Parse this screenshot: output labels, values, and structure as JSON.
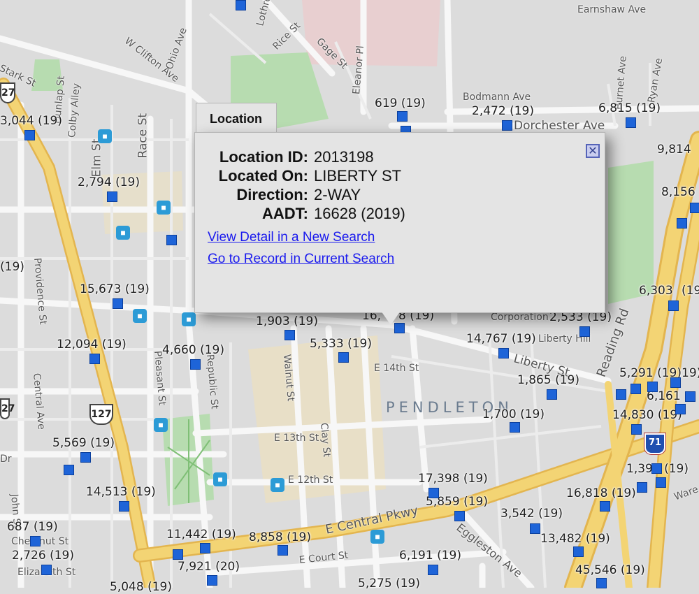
{
  "colors": {
    "marker": "#1e64d8",
    "highway": "#f0cc6a",
    "park": "#b7dcb0",
    "campus": "#eadfc3",
    "popup_bg": "#e4e4e4",
    "link": "#1a1aee"
  },
  "popup": {
    "tab_label": "Location",
    "fields": [
      {
        "key": "Location ID:",
        "value": "2013198"
      },
      {
        "key": "Located On:",
        "value": "LIBERTY ST"
      },
      {
        "key": "Direction:",
        "value": "2-WAY"
      },
      {
        "key": "AADT:",
        "value": "16628 (2019)"
      }
    ],
    "links": [
      {
        "label": "View Detail in a New Search"
      },
      {
        "label": "Go to Record in Current Search"
      }
    ],
    "close_icon": "close-x-icon"
  },
  "count_labels": [
    "3,044 (19)",
    "619 (19)",
    "2,472 (19)",
    "6,815 (19)",
    "9,814",
    "8,156",
    "2,794 (19)",
    "15,673 (19)",
    "1,903 (19)",
    "16,",
    "8 (19)",
    "2,533 (19)",
    "6,303",
    "(19",
    "12,094 (19)",
    "4,660 (19)",
    "5,333 (19)",
    "14,767 (19)",
    "1,865 (19)",
    "5,291 (19)",
    "6,161",
    "(19)",
    "14,830 (19)",
    "1,700 (19)",
    "5,569 (19)",
    "17,398 (19)",
    "1,394 (19)",
    "14,513 (19)",
    "5,859 (19)",
    "16,818 (19)",
    "3,542 (19)",
    "687 (19)",
    "13,482 (19)",
    "11,442 (19)",
    "8,858 (19)",
    "2,726 (19)",
    "6,191 (19)",
    "7,921 (20)",
    "45,546 (19)",
    "5,275 (19)",
    "5,048 (19)",
    "19)"
  ],
  "streets": [
    "Earnshaw Ave",
    "Bodmann Ave",
    "Dorchester Ave",
    "Rice St",
    "Gage St",
    "Eleanor Pl",
    "W Clifton Ave",
    "Ohio Ave",
    "Stark St",
    "Colby Alley",
    "Dunlap St",
    "Race St",
    "Elm St",
    "Providence St",
    "Central Ave",
    "Pleasant St",
    "Republic St",
    "Walnut St",
    "Liberty St",
    "E 14th St",
    "E 13th St",
    "Clay St",
    "E 12th St",
    "E Central Pkwy",
    "Eggleston Ave",
    "E Court St",
    "John St",
    "Chestnut St",
    "Elizabeth St",
    "Reading Rd",
    "Corporation",
    "Liberty Hill",
    "Burnet Ave",
    "Ryan Ave",
    "Ware",
    "Dr",
    "Lothrop"
  ],
  "neighborhood": "PENDLETON",
  "route_shields": [
    "27",
    "127",
    "27",
    "71"
  ],
  "transit_icon": "streetcar-stop-icon"
}
